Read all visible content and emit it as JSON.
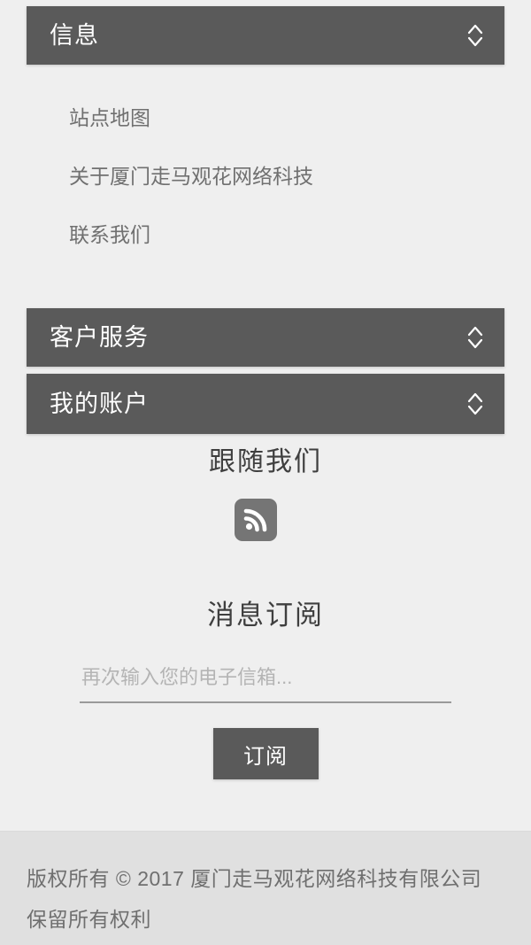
{
  "accordions": [
    {
      "key": "info",
      "label": "信息",
      "icon": "chevron-up-down-icon",
      "expanded": true,
      "links": [
        {
          "label": "站点地图"
        },
        {
          "label": "关于厦门走马观花网络科技"
        },
        {
          "label": "联系我们"
        }
      ]
    },
    {
      "key": "service",
      "label": "客户服务",
      "icon": "chevron-up-down-icon",
      "expanded": false,
      "links": []
    },
    {
      "key": "account",
      "label": "我的账户",
      "icon": "chevron-up-down-icon",
      "expanded": false,
      "links": []
    }
  ],
  "follow": {
    "heading": "跟随我们",
    "socials": [
      {
        "name": "rss-icon",
        "label": "RSS"
      }
    ]
  },
  "newsletter": {
    "heading": "消息订阅",
    "placeholder": "再次输入您的电子信箱...",
    "value": "",
    "submit_label": "订阅"
  },
  "footer": {
    "copyright": "版权所有 © 2017 厦门走马观花网络科技有限公司 保留所有权利"
  },
  "colors": {
    "page_background": "#efefef",
    "bar_background": "#5a5a5a",
    "bar_text": "#ffffff",
    "link_text": "#707070",
    "heading_text": "#3f3f3f",
    "footer_background": "#e0e0e0",
    "footer_text": "#6f6f6f",
    "social_icon_background": "#757575",
    "input_underline": "#9a9a9a",
    "placeholder_text": "#b4b4b4"
  }
}
